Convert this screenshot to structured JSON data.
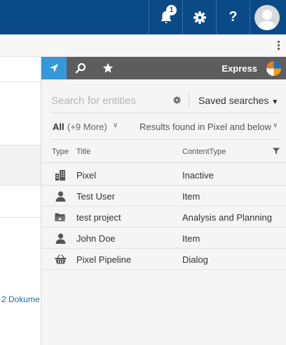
{
  "header": {
    "notification_count": "1",
    "help_label": "?"
  },
  "background": {
    "link_text": "2 Dokume"
  },
  "panel": {
    "brand": "Express",
    "search": {
      "placeholder": "Search for entities",
      "saved_searches_label": "Saved searches",
      "saved_caret": "▼"
    },
    "filters": {
      "all_label": "All",
      "more_label": "(+9 More)",
      "scope_label": "Results found in Pixel and below"
    },
    "table": {
      "columns": {
        "type": "Type",
        "title": "Title",
        "content_type": "ContentType"
      },
      "rows": [
        {
          "icon": "building-icon",
          "title": "Pixel",
          "content_type": "Inactive"
        },
        {
          "icon": "user-icon",
          "title": "Test User",
          "content_type": "Item"
        },
        {
          "icon": "folder-icon",
          "title": "test project",
          "content_type": "Analysis and Planning"
        },
        {
          "icon": "user-icon",
          "title": "John Doe",
          "content_type": "Item"
        },
        {
          "icon": "basket-icon",
          "title": "Pixel Pipeline",
          "content_type": "Dialog"
        }
      ]
    }
  },
  "colors": {
    "header_bg": "#0a4a86",
    "active_tab": "#3498db",
    "tab_bar": "#5d5d5d",
    "link": "#1e6bb8"
  }
}
